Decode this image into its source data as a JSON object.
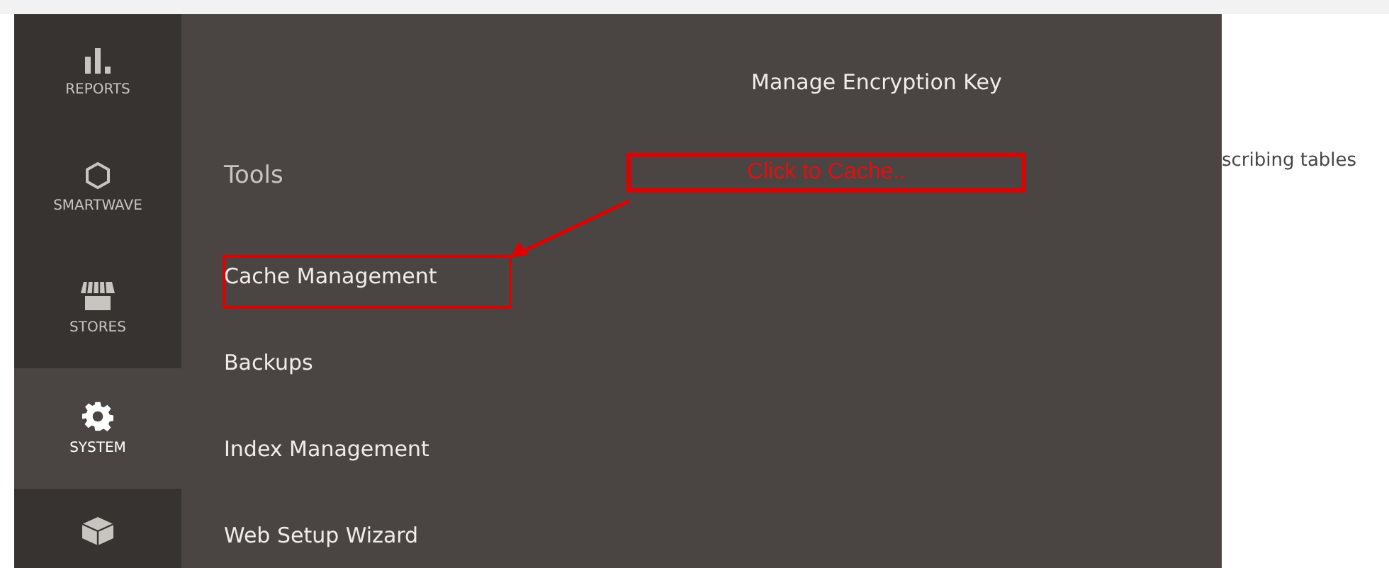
{
  "sidebar": {
    "items": [
      {
        "kind": "reports",
        "label": "REPORTS",
        "selected": false
      },
      {
        "kind": "hexagon",
        "label": "SMARTWAVE",
        "selected": false
      },
      {
        "kind": "stores",
        "label": "STORES",
        "selected": false
      },
      {
        "kind": "system",
        "label": "SYSTEM",
        "selected": true
      },
      {
        "kind": "blocks",
        "selected": false
      }
    ]
  },
  "flyout": {
    "top_link": "Manage Encryption Key",
    "section_title": "Tools",
    "items": [
      "Cache Management",
      "Backups",
      "Index Management",
      "Web Setup Wizard"
    ]
  },
  "annotation": {
    "callout": "Click to Cache.."
  },
  "page": {
    "partial_text": "scribing tables"
  }
}
